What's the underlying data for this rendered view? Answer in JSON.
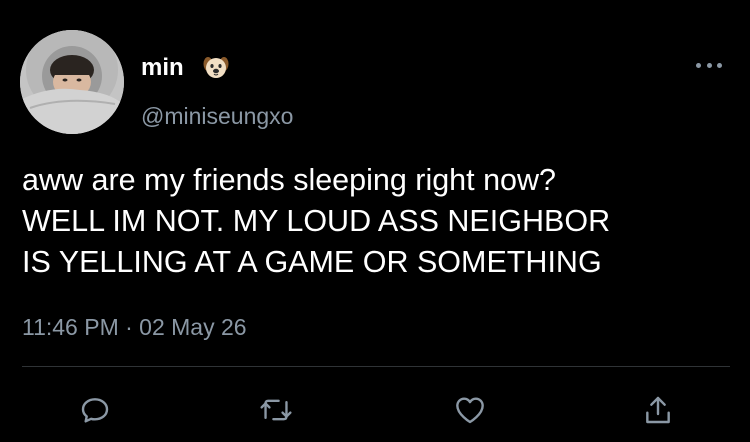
{
  "author": {
    "display_name": "min",
    "name_emoji": "dog-face-emoji",
    "handle": "@miniseungxo"
  },
  "tweet": {
    "lines": [
      "aww are my friends sleeping right now?",
      "WELL IM NOT. MY LOUD ASS NEIGHBOR",
      "IS YELLING AT A GAME OR SOMETHING"
    ]
  },
  "meta": {
    "timestamp": "11:46 PM · 02 May 26"
  },
  "actions": {
    "icons": [
      "reply-icon",
      "retweet-icon",
      "like-icon",
      "share-icon"
    ]
  },
  "colors": {
    "background": "#000000",
    "text": "#ffffff",
    "secondary": "#8b98a5",
    "divider": "#2f3336"
  }
}
